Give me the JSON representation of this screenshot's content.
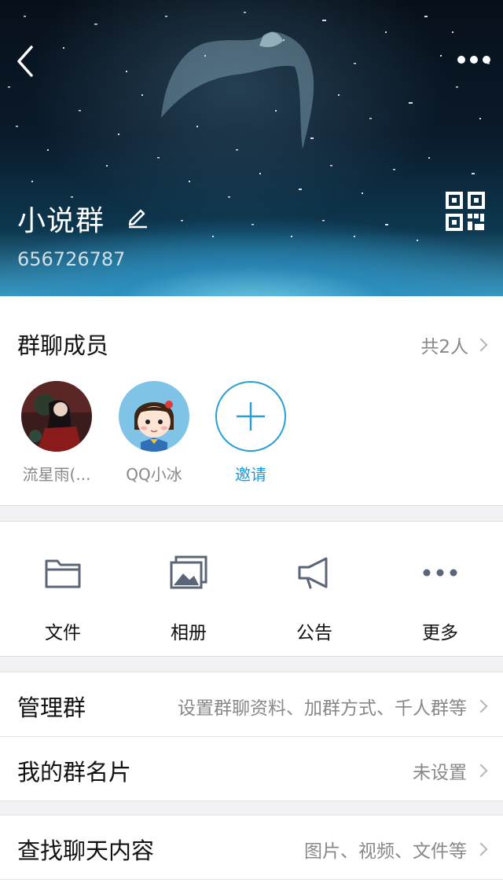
{
  "header": {
    "group_name": "小说群",
    "group_id": "656726787"
  },
  "members": {
    "title": "群聊成员",
    "count": "共2人",
    "list": [
      {
        "name": "流星雨(..."
      },
      {
        "name": "QQ小冰"
      }
    ],
    "invite_label": "邀请"
  },
  "tools": [
    {
      "label": "文件",
      "icon": "folder-icon"
    },
    {
      "label": "相册",
      "icon": "album-icon"
    },
    {
      "label": "公告",
      "icon": "megaphone-icon"
    },
    {
      "label": "更多",
      "icon": "more-icon"
    }
  ],
  "rows": {
    "manage": {
      "label": "管理群",
      "value": "设置群聊资料、加群方式、千人群等"
    },
    "card": {
      "label": "我的群名片",
      "value": "未设置"
    },
    "search": {
      "label": "查找聊天内容",
      "value": "图片、视频、文件等"
    }
  },
  "colors": {
    "accent": "#1e9ad8",
    "text_primary": "#111111",
    "text_secondary": "#888888"
  }
}
